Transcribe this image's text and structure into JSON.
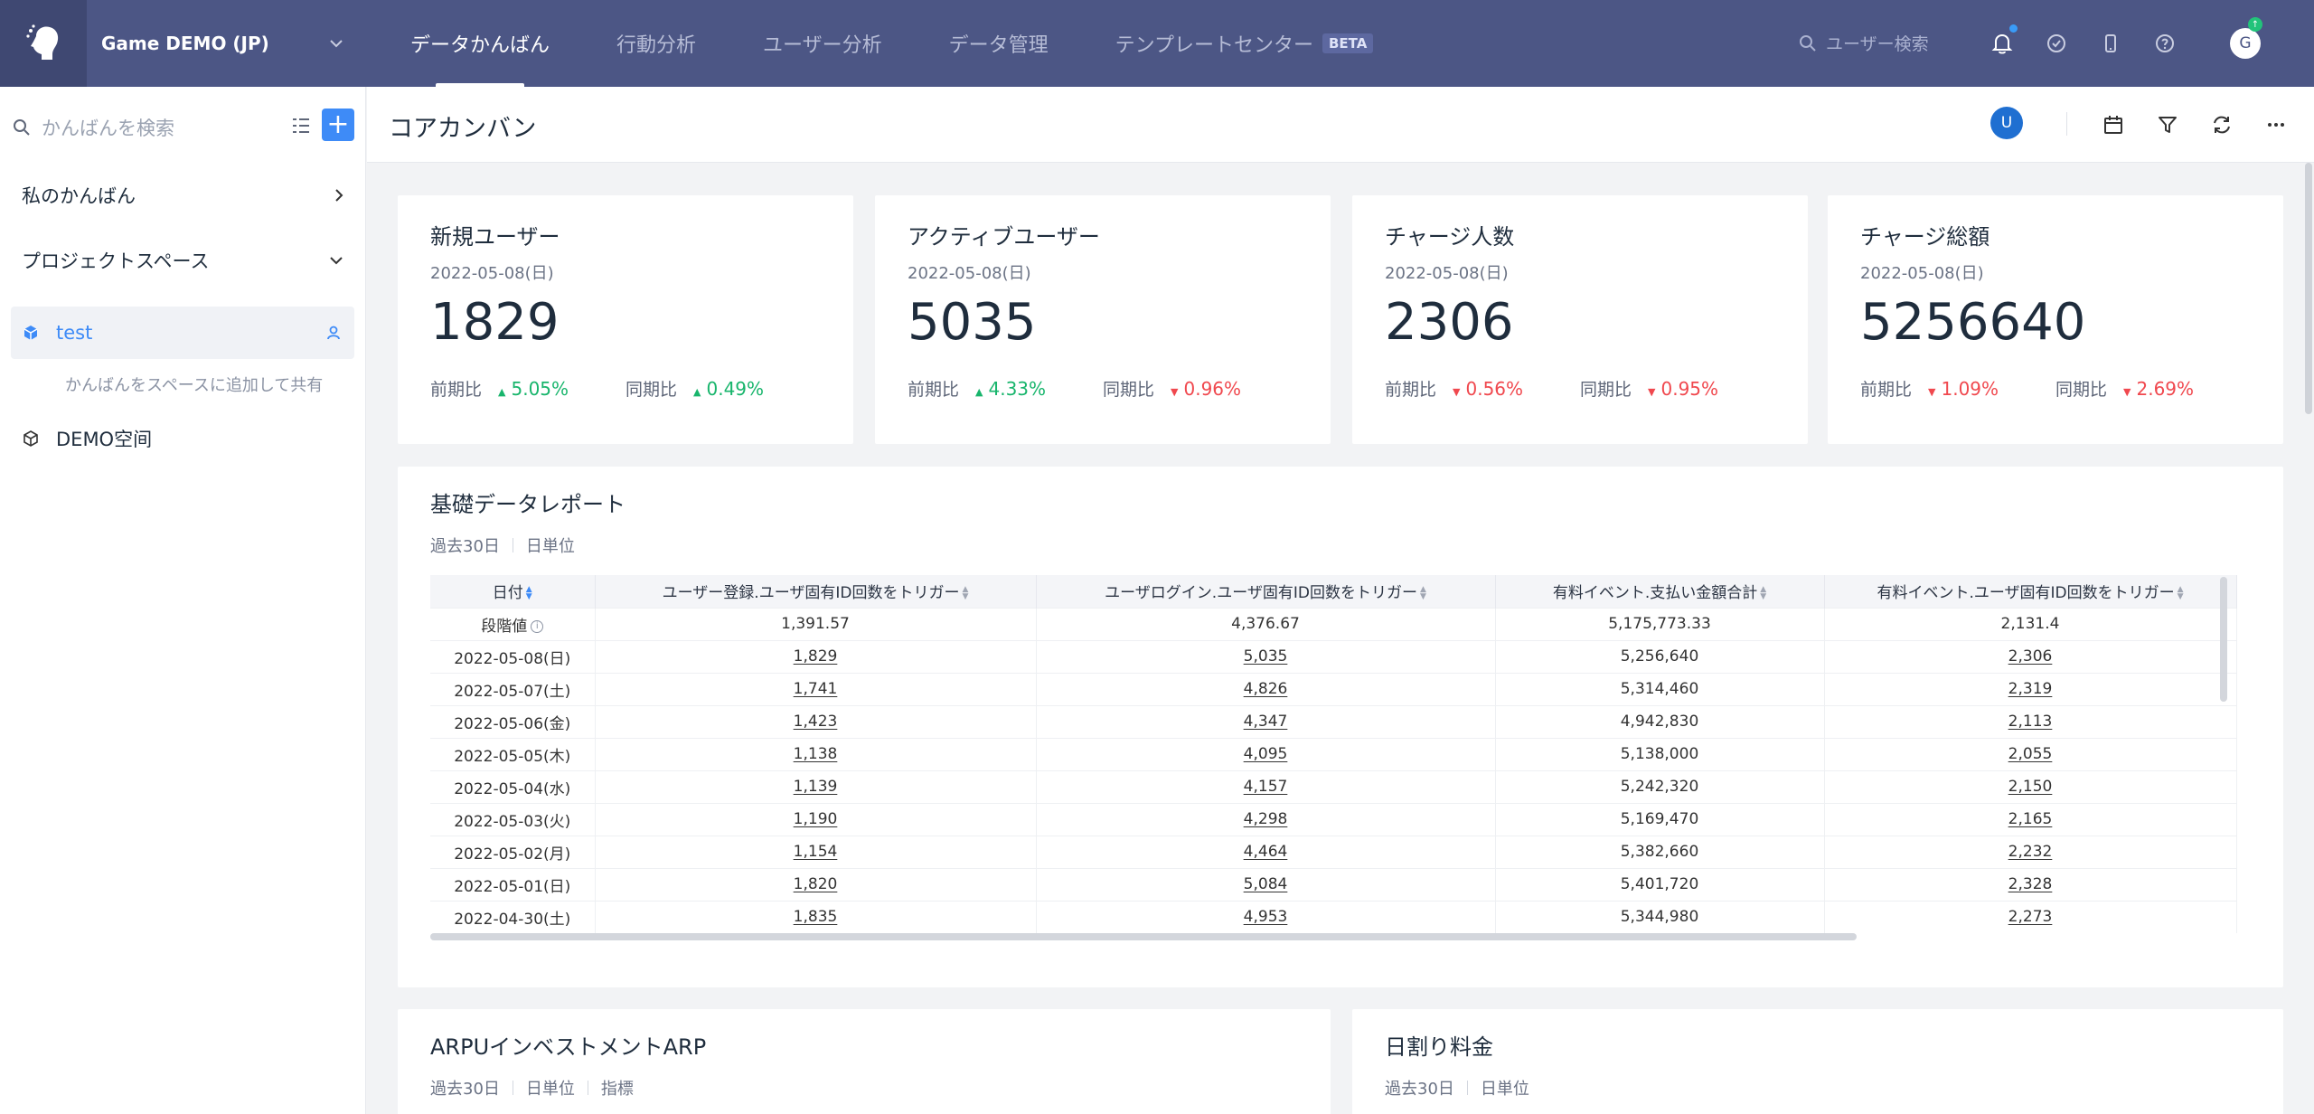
{
  "topnav": {
    "project_name": "Game DEMO (JP)",
    "tabs": [
      {
        "label": "データかんばん",
        "active": true
      },
      {
        "label": "行動分析",
        "active": false
      },
      {
        "label": "ユーザー分析",
        "active": false
      },
      {
        "label": "データ管理",
        "active": false
      },
      {
        "label": "テンプレートセンター",
        "active": false,
        "badge": "BETA"
      }
    ],
    "search_placeholder": "ユーザー検索",
    "avatar_initial": "G",
    "accent": "#4c5685"
  },
  "sidebar": {
    "search_placeholder": "かんばんを検索",
    "sections": [
      {
        "label": "私のかんばん"
      },
      {
        "label": "プロジェクトスペース"
      }
    ],
    "items": [
      {
        "label": "test"
      },
      {
        "label": "DEMO空间"
      }
    ],
    "hint": "かんばんをスペースに追加して共有"
  },
  "header": {
    "title": "コアカンバン",
    "user_initial": "U"
  },
  "kpis": [
    {
      "title": "新規ユーザー",
      "date": "2022-05-08(日)",
      "value": "1829",
      "cmp1_label": "前期比",
      "cmp1_value": "5.05%",
      "cmp1_dir": "up",
      "cmp2_label": "同期比",
      "cmp2_value": "0.49%",
      "cmp2_dir": "up"
    },
    {
      "title": "アクティブユーザー",
      "date": "2022-05-08(日)",
      "value": "5035",
      "cmp1_label": "前期比",
      "cmp1_value": "4.33%",
      "cmp1_dir": "up",
      "cmp2_label": "同期比",
      "cmp2_value": "0.96%",
      "cmp2_dir": "down"
    },
    {
      "title": "チャージ人数",
      "date": "2022-05-08(日)",
      "value": "2306",
      "cmp1_label": "前期比",
      "cmp1_value": "0.56%",
      "cmp1_dir": "down",
      "cmp2_label": "同期比",
      "cmp2_value": "0.95%",
      "cmp2_dir": "down"
    },
    {
      "title": "チャージ総額",
      "date": "2022-05-08(日)",
      "value": "5256640",
      "cmp1_label": "前期比",
      "cmp1_value": "1.09%",
      "cmp1_dir": "down",
      "cmp2_label": "同期比",
      "cmp2_value": "2.69%",
      "cmp2_dir": "down"
    }
  ],
  "report": {
    "title": "基礎データレポート",
    "meta": [
      "過去30日",
      "日単位"
    ],
    "columns": [
      "日付",
      "ユーザー登録.ユーザ固有ID回数をトリガー",
      "ユーザログイン.ユーザ固有ID回数をトリガー",
      "有料イベント.支払い金額合計",
      "有料イベント.ユーザ固有ID回数をトリガー"
    ],
    "stage_label": "段階値",
    "stage_values": [
      "1,391.57",
      "4,376.67",
      "5,175,773.33",
      "2,131.4"
    ],
    "rows": [
      [
        "2022-05-08(日)",
        "1,829",
        "5,035",
        "5,256,640",
        "2,306"
      ],
      [
        "2022-05-07(土)",
        "1,741",
        "4,826",
        "5,314,460",
        "2,319"
      ],
      [
        "2022-05-06(金)",
        "1,423",
        "4,347",
        "4,942,830",
        "2,113"
      ],
      [
        "2022-05-05(木)",
        "1,138",
        "4,095",
        "5,138,000",
        "2,055"
      ],
      [
        "2022-05-04(水)",
        "1,139",
        "4,157",
        "5,242,320",
        "2,150"
      ],
      [
        "2022-05-03(火)",
        "1,190",
        "4,298",
        "5,169,470",
        "2,165"
      ],
      [
        "2022-05-02(月)",
        "1,154",
        "4,464",
        "5,382,660",
        "2,232"
      ],
      [
        "2022-05-01(日)",
        "1,820",
        "5,084",
        "5,401,720",
        "2,328"
      ],
      [
        "2022-04-30(土)",
        "1,835",
        "4,953",
        "5,344,980",
        "2,273"
      ]
    ]
  },
  "bottom_cards": [
    {
      "title": "ARPUインベストメントARP",
      "meta": [
        "過去30日",
        "日単位",
        "指標"
      ]
    },
    {
      "title": "日割り料金",
      "meta": [
        "過去30日",
        "日単位"
      ]
    }
  ]
}
